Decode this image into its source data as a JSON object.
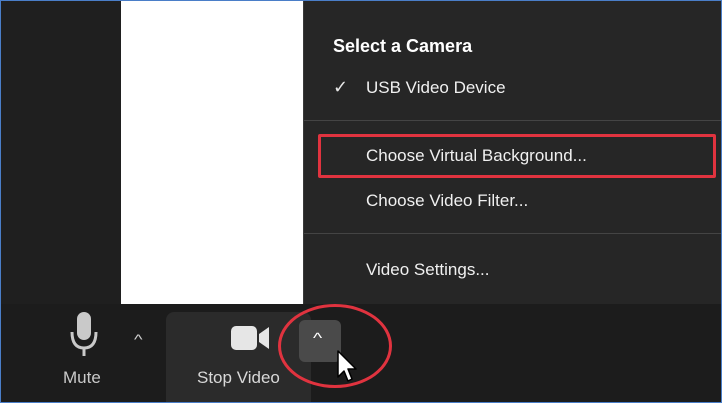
{
  "camera_menu": {
    "header": "Select a Camera",
    "items": [
      {
        "label": "USB Video Device",
        "checked": true
      },
      {
        "label": "Choose Virtual Background...",
        "highlighted": true
      },
      {
        "label": "Choose Video Filter..."
      },
      {
        "label": "Video Settings..."
      }
    ]
  },
  "toolbar": {
    "mute_label": "Mute",
    "stop_video_label": "Stop Video"
  },
  "icons": {
    "check": "checkmark-icon",
    "mic": "microphone-icon",
    "camera": "video-camera-icon",
    "caret": "caret-up-icon",
    "cursor": "mouse-pointer-icon"
  },
  "colors": {
    "annotation_red": "#e0333f",
    "menu_bg": "#262626",
    "toolbar_bg": "#1c1c1c"
  }
}
